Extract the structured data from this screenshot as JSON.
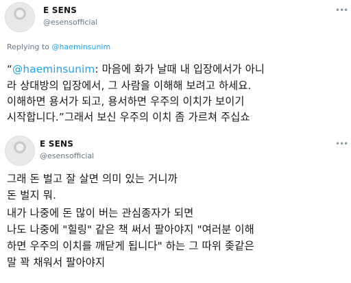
{
  "tweet1": {
    "author_name": "E SENS",
    "author_handle": "@esensofficial",
    "more_icon": "ellipsis-icon",
    "replying_prefix": "Replying to ",
    "replying_to": "@haeminsunim",
    "body_lines": [
      {
        "prefix": "“",
        "mention": "@haeminsunim",
        "text": ": 마음에 화가 날때 내 입장에서가 아니"
      },
      {
        "text": "라 상대방의 입장에서, 그 사람을 이해해 보려고 하세요."
      },
      {
        "text": "이해하면 용서가 되고, 용서하면 우주의 이치가 보이기"
      },
      {
        "text": "시작합니다.”그래서 보신 우주의 이치 좀 가르쳐 주십쇼"
      }
    ]
  },
  "tweet2": {
    "author_name": "E SENS",
    "author_handle": "@esensofficial",
    "more_icon": "ellipsis-icon",
    "body_lines": [
      "그래 돈 벌고 잘 살면 의미 있는 거니까",
      "돈 벌지 뭐.",
      "내가 나중에 돈 많이 버는 관심종자가 되면",
      "나도 나중에 \"힐링\" 같은 책 써서 팔아야지 \"여러분 이해",
      "하면 우주의 이치를 깨닫게 됩니다\" 하는 그 따위 좆같은",
      "말 꽉 채워서 팔아야지"
    ]
  }
}
